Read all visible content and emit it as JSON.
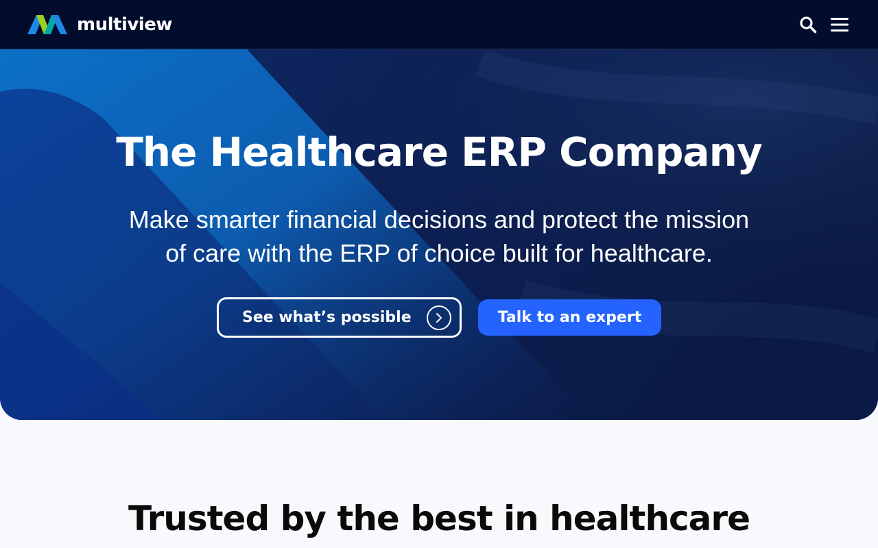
{
  "header": {
    "brand_name": "multiview",
    "logo_colors": {
      "blue": "#1e88e5",
      "teal": "#00a9a5",
      "lime": "#9bd11e"
    },
    "icons": [
      "search-icon",
      "hamburger-menu-icon"
    ]
  },
  "hero": {
    "title": "The Healthcare ERP Company",
    "subtitle_line1": "Make smarter financial decisions and protect the mission",
    "subtitle_line2": "of care with the ERP of choice built for healthcare.",
    "secondary_cta": {
      "label": "See what’s possible",
      "icon": "chevron-right-icon"
    },
    "primary_cta": {
      "label": "Talk to an expert"
    },
    "colors": {
      "background": "#0b1f4e",
      "accent": "#2563ff",
      "stripe": "#0a78d1"
    }
  },
  "trusted": {
    "title": "Trusted by the best in healthcare"
  }
}
